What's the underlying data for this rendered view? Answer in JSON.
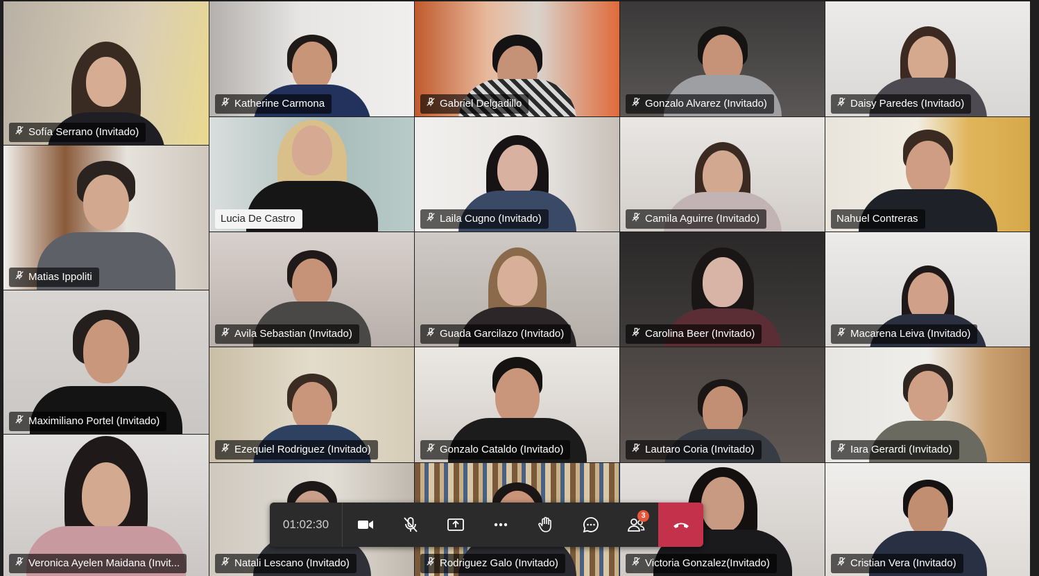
{
  "participants": [
    {
      "name": "Sofía Serrano (Invitado)",
      "muted": true
    },
    {
      "name": "Katherine Carmona",
      "muted": true
    },
    {
      "name": "Gabriel Delgadillo",
      "muted": true
    },
    {
      "name": "Gonzalo Alvarez (Invitado)",
      "muted": true
    },
    {
      "name": "Daisy Paredes (Invitado)",
      "muted": true
    },
    {
      "name": "Lucia De Castro",
      "muted": false
    },
    {
      "name": "Laila Cugno (Invitado)",
      "muted": true
    },
    {
      "name": "Camila Aguirre (Invitado)",
      "muted": true
    },
    {
      "name": "Nahuel Contreras",
      "muted": false
    },
    {
      "name": "Matias Ippoliti",
      "muted": true
    },
    {
      "name": "Avila Sebastian (Invitado)",
      "muted": true
    },
    {
      "name": "Guada Garcilazo (Invitado)",
      "muted": true
    },
    {
      "name": "Carolina Beer (Invitado)",
      "muted": true
    },
    {
      "name": "Macarena Leiva (Invitado)",
      "muted": true
    },
    {
      "name": "Maximiliano Portel (Invitado)",
      "muted": true
    },
    {
      "name": "Ezequiel Rodriguez (Invitado)",
      "muted": true
    },
    {
      "name": "Gonzalo Cataldo (Invitado)",
      "muted": true
    },
    {
      "name": "Lautaro Coria (Invitado)",
      "muted": true
    },
    {
      "name": "Iara Gerardi (Invitado)",
      "muted": true
    },
    {
      "name": "Veronica Ayelen Maidana (Invit...",
      "muted": true
    },
    {
      "name": "Natali Lescano (Invitado)",
      "muted": true
    },
    {
      "name": "Rodriguez Galo (Invitado)",
      "muted": true
    },
    {
      "name": "Victoria Gonzalez(Invitado)",
      "muted": true
    },
    {
      "name": "Cristian Vera (Invitado)",
      "muted": true
    }
  ],
  "toolbar": {
    "timer": "01:02:30",
    "buttons": [
      "camera-icon",
      "mic-off-icon",
      "share-screen-icon",
      "more-icon",
      "raise-hand-icon",
      "chat-icon",
      "participants-icon",
      "hang-up-icon"
    ],
    "participants_badge": "3",
    "hangup_color": "#c4314b"
  }
}
